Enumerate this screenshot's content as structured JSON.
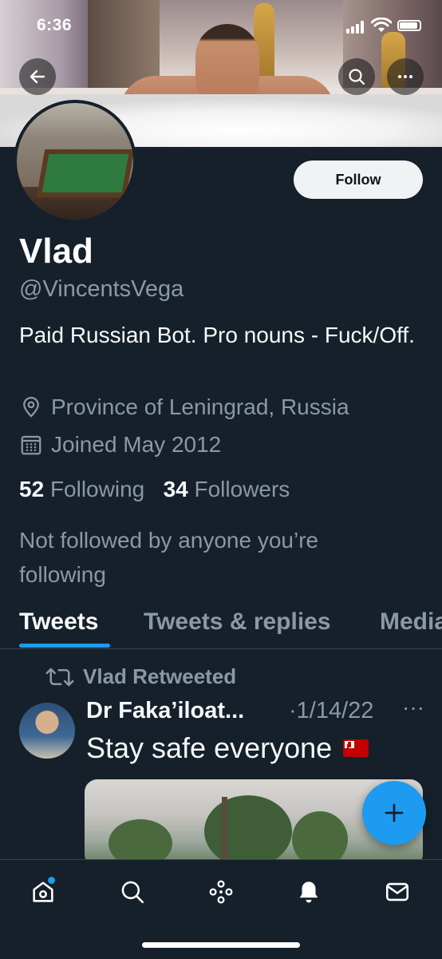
{
  "status_bar": {
    "time": "6:36"
  },
  "profile": {
    "name": "Vlad",
    "handle": "@VincentsVega",
    "bio": "Paid Russian Bot. Pro nouns - Fuck/Off.",
    "location": "Province of Leningrad, Russia",
    "joined": "Joined May 2012",
    "following_count": "52",
    "following_label": "Following",
    "followers_count": "34",
    "followers_label": "Followers",
    "not_followed_text": "Not followed by anyone you’re following",
    "follow_button_label": "Follow"
  },
  "tabs": [
    {
      "label": "Tweets",
      "active": true
    },
    {
      "label": "Tweets & replies",
      "active": false
    },
    {
      "label": "Media",
      "active": false
    }
  ],
  "tweet": {
    "retweet_label": "Vlad Retweeted",
    "author": "Dr Faka’iloat...",
    "date": "·1/14/22",
    "more": "···",
    "text": "Stay safe everyone"
  },
  "icons": {
    "back": "back-arrow-icon",
    "search": "search-icon",
    "more": "more-icon",
    "location": "location-pin-icon",
    "calendar": "calendar-icon",
    "retweet": "retweet-icon",
    "compose": "plus-icon",
    "nav": [
      "home-icon",
      "search-icon",
      "spaces-icon",
      "notifications-icon",
      "messages-icon"
    ]
  },
  "colors": {
    "background": "#15202b",
    "accent": "#1d9bf0",
    "secondary_text": "#8b98a5"
  }
}
